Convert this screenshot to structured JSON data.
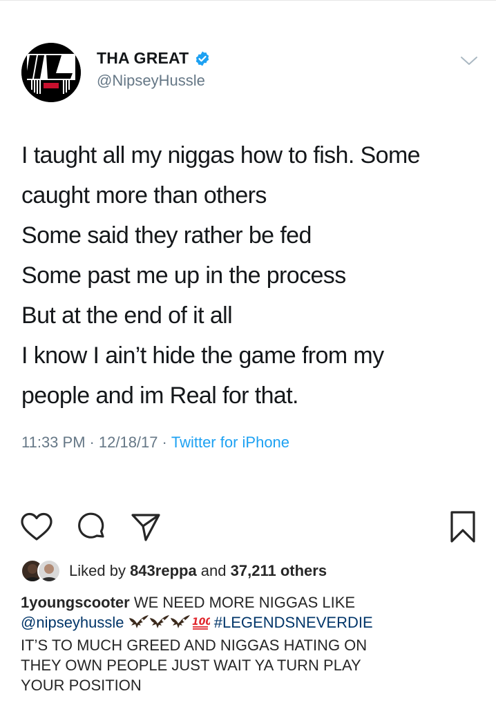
{
  "tweet": {
    "display_name": "THA GREAT",
    "handle": "@NipseyHussle",
    "avatar_icon": "tmc-logo-icon",
    "verified_icon": "verified-badge-icon",
    "lines": [
      "I taught all my niggas how to fish. Some",
      "caught more than others",
      "Some said they rather be fed",
      "Some past me up in the process",
      "But at the end of it all",
      "I know I ain’t hide the game from my",
      "people and im Real for that."
    ],
    "time": "11:33 PM",
    "date": "12/18/17",
    "separator": "·",
    "source": "Twitter for iPhone"
  },
  "post": {
    "actions": {
      "like_icon": "heart-icon",
      "comment_icon": "comment-icon",
      "share_icon": "paper-plane-icon",
      "save_icon": "bookmark-icon"
    },
    "likes": {
      "prefix": "Liked by ",
      "user": "843reppa",
      "middle": " and ",
      "count": "37,211 others"
    },
    "caption": {
      "user": "1youngscooter",
      "text_1": " WE NEED MORE NIGGAS LIKE",
      "mention": "@nipseyhussle",
      "emoji_1": "eagle-emoji",
      "emoji_2": "hundred-points-emoji",
      "hashtag": "#LEGENDSNEVERDIE",
      "text_2": "IT’S TO MUCH GREED AND NIGGAS HATING ON",
      "text_3": "THEY OWN PEOPLE JUST WAIT YA TURN PLAY",
      "text_4": "YOUR POSITION"
    }
  },
  "colors": {
    "twitter_blue": "#1da1f2",
    "meta_gray": "#657786",
    "instagram_link": "#003569",
    "text": "#14171a"
  }
}
